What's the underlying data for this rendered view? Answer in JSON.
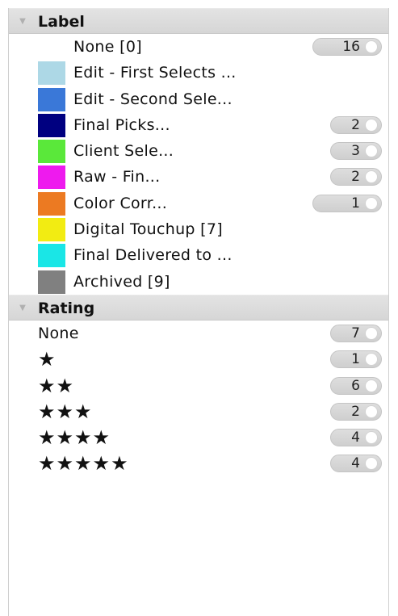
{
  "sections": {
    "label": {
      "title": "Label",
      "items": [
        {
          "text": "None [0]",
          "count": "16",
          "color": ""
        },
        {
          "text": "Edit - First Selects ...",
          "count": "",
          "color": "#add8e6"
        },
        {
          "text": "Edit - Second Sele...",
          "count": "",
          "color": "#3a78d8"
        },
        {
          "text": "Final Picks...",
          "count": "2",
          "color": "#000080"
        },
        {
          "text": "Client Sele...",
          "count": "3",
          "color": "#5ae83a"
        },
        {
          "text": "Raw - Fin...",
          "count": "2",
          "color": "#ee1aee"
        },
        {
          "text": "Color Corr...",
          "count": "1",
          "color": "#ec7a22"
        },
        {
          "text": "Digital Touchup [7]",
          "count": "",
          "color": "#f2ec12"
        },
        {
          "text": "Final Delivered to ...",
          "count": "",
          "color": "#1ae6e6"
        },
        {
          "text": "Archived [9]",
          "count": "",
          "color": "#808080"
        }
      ]
    },
    "rating": {
      "title": "Rating",
      "items": [
        {
          "text": "None",
          "stars": "",
          "count": "7"
        },
        {
          "text": "",
          "stars": "★",
          "count": "1"
        },
        {
          "text": "",
          "stars": "★★",
          "count": "6"
        },
        {
          "text": "",
          "stars": "★★★",
          "count": "2"
        },
        {
          "text": "",
          "stars": "★★★★",
          "count": "4"
        },
        {
          "text": "",
          "stars": "★★★★★",
          "count": "4"
        }
      ]
    }
  },
  "icons": {
    "disclosure": "▼"
  }
}
